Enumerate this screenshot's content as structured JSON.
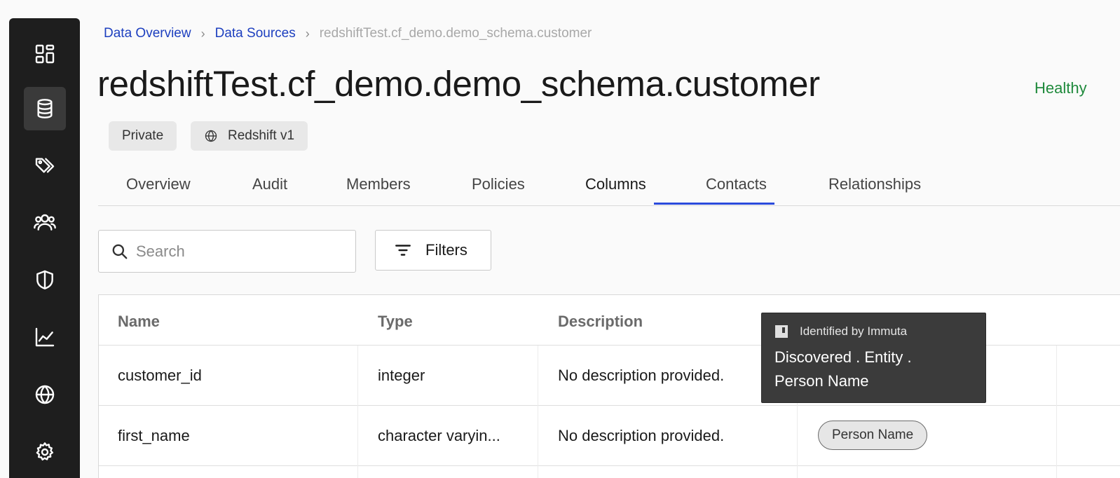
{
  "sidebar": {
    "items": [
      {
        "icon": "dashboard-icon"
      },
      {
        "icon": "database-icon",
        "active": true
      },
      {
        "icon": "tags-icon"
      },
      {
        "icon": "users-icon"
      },
      {
        "icon": "shield-icon"
      },
      {
        "icon": "chart-icon"
      },
      {
        "icon": "globe-icon"
      },
      {
        "icon": "gear-icon"
      }
    ]
  },
  "breadcrumb": {
    "items": [
      "Data Overview",
      "Data Sources"
    ],
    "current": "redshiftTest.cf_demo.demo_schema.customer"
  },
  "header": {
    "title": "redshiftTest.cf_demo.demo_schema.customer",
    "status": "Healthy",
    "status_color": "#1f8a3c",
    "chips": [
      "Private",
      "Redshift v1"
    ]
  },
  "tabs": {
    "items": [
      "Overview",
      "Audit",
      "Members",
      "Policies",
      "Columns",
      "Contacts",
      "Relationships"
    ],
    "active": "Columns",
    "accent": "#2b4bdc"
  },
  "search": {
    "placeholder": "Search",
    "value": ""
  },
  "filters": {
    "label": "Filters"
  },
  "table": {
    "headers": [
      "Name",
      "Type",
      "Description"
    ],
    "rows": [
      {
        "name": "customer_id",
        "type": "integer",
        "description": "No description provided."
      },
      {
        "name": "first_name",
        "type": "character varyin...",
        "description": "No description provided.",
        "tag": "Person Name"
      }
    ]
  },
  "tooltip": {
    "heading": "Identified by Immuta",
    "body": "Discovered . Entity . Person Name"
  }
}
